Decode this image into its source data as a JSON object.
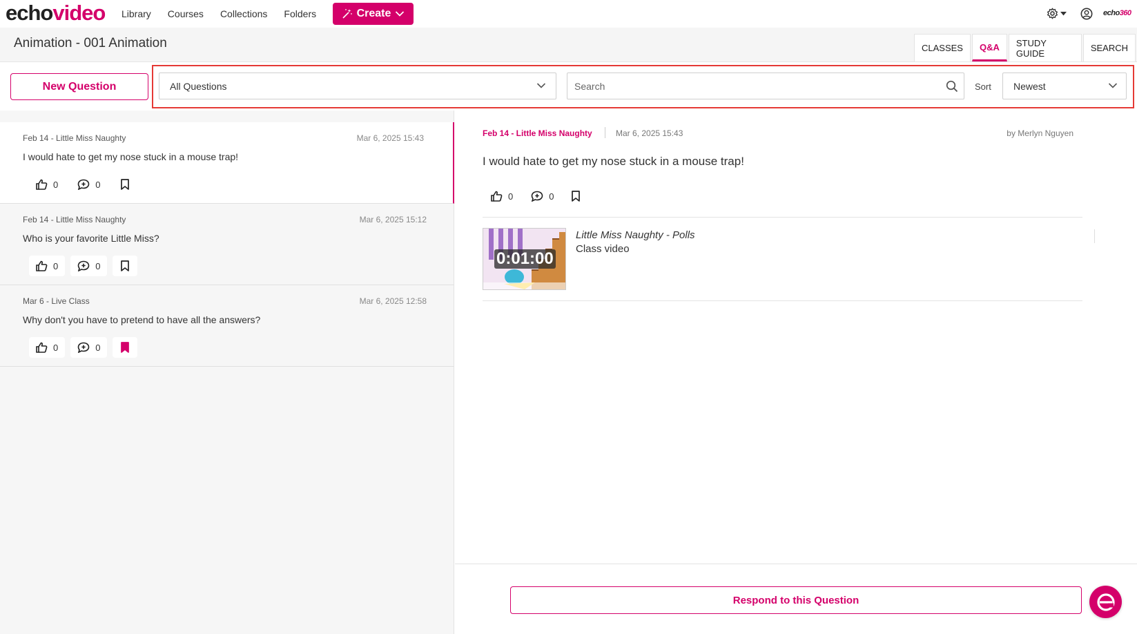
{
  "brand": {
    "logo_echo": "echo",
    "logo_video": "video",
    "corner_logo_echo": "echo",
    "corner_logo_360": "360",
    "accent_color": "#d4006a"
  },
  "nav": {
    "links": [
      "Library",
      "Courses",
      "Collections",
      "Folders"
    ],
    "create_label": "Create"
  },
  "header": {
    "title": "Animation - 001 Animation",
    "tabs": [
      {
        "label": "CLASSES",
        "active": false
      },
      {
        "label": "Q&A",
        "active": true
      },
      {
        "label": "STUDY GUIDE",
        "active": false
      },
      {
        "label": "SEARCH",
        "active": false
      }
    ]
  },
  "toolbar": {
    "new_question_label": "New Question",
    "filter_value": "All Questions",
    "search_placeholder": "Search",
    "sort_label": "Sort",
    "sort_value": "Newest"
  },
  "questions": [
    {
      "course": "Feb 14 - Little Miss Naughty",
      "date": "Mar 6, 2025 15:43",
      "text": "I would hate to get my nose stuck in a mouse trap!",
      "likes": "0",
      "replies": "0",
      "bookmarked": false,
      "selected": true
    },
    {
      "course": "Feb 14 - Little Miss Naughty",
      "date": "Mar 6, 2025 15:12",
      "text": "Who is your favorite Little Miss?",
      "likes": "0",
      "replies": "0",
      "bookmarked": false,
      "selected": false
    },
    {
      "course": "Mar 6 - Live Class",
      "date": "Mar 6, 2025 12:58",
      "text": "Why don't you have to pretend to have all the answers?",
      "likes": "0",
      "replies": "0",
      "bookmarked": true,
      "selected": false
    }
  ],
  "detail": {
    "course": "Feb 14 - Little Miss Naughty",
    "date": "Mar 6, 2025 15:43",
    "author": "by Merlyn Nguyen",
    "text": "I would hate to get my nose stuck in a mouse trap!",
    "likes": "0",
    "replies": "0",
    "video": {
      "title": "Little Miss Naughty - Polls",
      "subtitle": "Class video",
      "timestamp": "0:01:00"
    },
    "respond_label": "Respond to this Question"
  }
}
